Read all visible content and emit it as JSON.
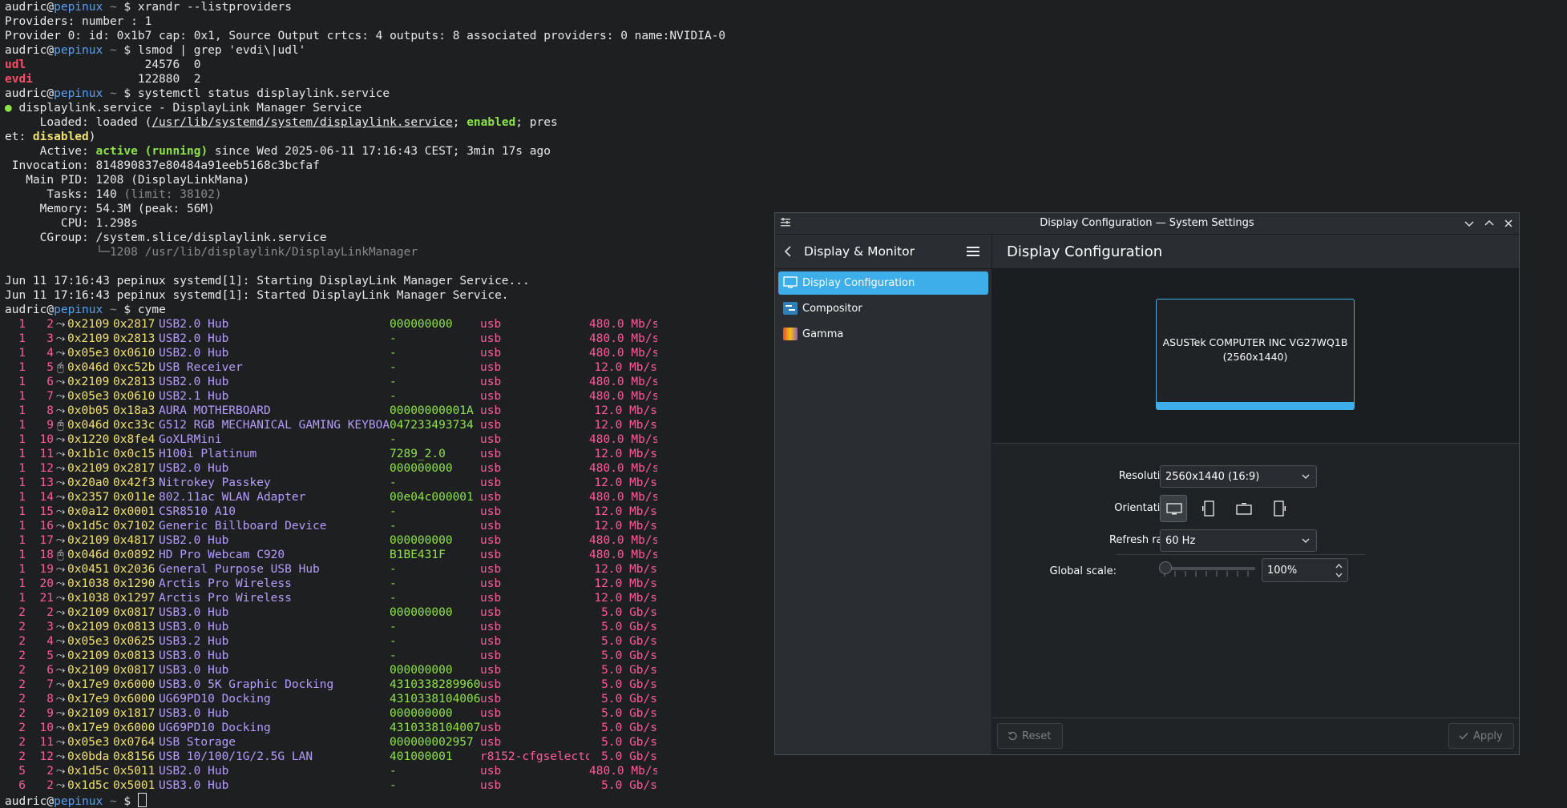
{
  "terminal": {
    "prompt_user": "audric@",
    "prompt_host": "pepinux",
    "prompt_tilde": " ~ ",
    "prompt_symbol": "$ ",
    "cmd1": "xrandr --listproviders",
    "out1a": "Providers: number : 1",
    "out1b": "Provider 0: id: 0x1b7 cap: 0x1, Source Output crtcs: 4 outputs: 8 associated providers: 0 name:NVIDIA-0",
    "cmd2": "lsmod | grep 'evdi\\|udl'",
    "mod1_name": "udl",
    "mod1_rest": "                 24576  0",
    "mod2_name": "evdi",
    "mod2_rest": "               122880  2",
    "cmd3": "systemctl status displaylink.service",
    "st_bullet": "●",
    "st_head": " displaylink.service - DisplayLink Manager Service",
    "st_loaded_pre": "     Loaded: loaded (",
    "st_loaded_path": "/usr/lib/systemd/system/displaylink.service",
    "st_loaded_sep": "; ",
    "st_enabled": "enabled",
    "st_loaded_post": "; pres",
    "st_et": "et: ",
    "st_disabled": "disabled",
    "st_close": ")",
    "st_active_pre": "     Active: ",
    "st_active_val": "active (running)",
    "st_active_post": " since Wed 2025-06-11 17:16:43 CEST; 3min 17s ago",
    "st_invocation": " Invocation: 814890837e80484a91eeb5168c3bcfaf",
    "st_pid": "   Main PID: 1208 (DisplayLinkMana)",
    "st_tasks_pre": "      Tasks: 140 ",
    "st_tasks_limit": "(limit: 38102)",
    "st_memory": "     Memory: 54.3M (peak: 56M)",
    "st_cpu": "        CPU: 1.298s",
    "st_cgroup": "     CGroup: /system.slice/displaylink.service",
    "st_cgroup_child": "             └─1208 /usr/lib/displaylink/DisplayLinkManager",
    "log1": "Jun 11 17:16:43 pepinux systemd[1]: Starting DisplayLink Manager Service...",
    "log2": "Jun 11 17:16:43 pepinux systemd[1]: Started DisplayLink Manager Service.",
    "cmd4": "cyme"
  },
  "cyme_rows": [
    {
      "bus": "1",
      "dev": "2",
      "icon": "⤳",
      "vid": "0x2109",
      "pid": "0x2817",
      "name": "USB2.0 Hub",
      "serial": "000000000",
      "driver": "usb",
      "speed": "480.0 Mb/s"
    },
    {
      "bus": "1",
      "dev": "3",
      "icon": "⤳",
      "vid": "0x2109",
      "pid": "0x2813",
      "name": "USB2.0 Hub",
      "serial": "-",
      "driver": "usb",
      "speed": "480.0 Mb/s"
    },
    {
      "bus": "1",
      "dev": "4",
      "icon": "⤳",
      "vid": "0x05e3",
      "pid": "0x0610",
      "name": "USB2.0 Hub",
      "serial": "-",
      "driver": "usb",
      "speed": "480.0 Mb/s"
    },
    {
      "bus": "1",
      "dev": "5",
      "icon": "🖰",
      "vid": "0x046d",
      "pid": "0xc52b",
      "name": "USB Receiver",
      "serial": "-",
      "driver": "usb",
      "speed": "12.0 Mb/s"
    },
    {
      "bus": "1",
      "dev": "6",
      "icon": "⤳",
      "vid": "0x2109",
      "pid": "0x2813",
      "name": "USB2.0 Hub",
      "serial": "-",
      "driver": "usb",
      "speed": "480.0 Mb/s"
    },
    {
      "bus": "1",
      "dev": "7",
      "icon": "⤳",
      "vid": "0x05e3",
      "pid": "0x0610",
      "name": "USB2.1 Hub",
      "serial": "-",
      "driver": "usb",
      "speed": "480.0 Mb/s"
    },
    {
      "bus": "1",
      "dev": "8",
      "icon": "⤳",
      "vid": "0x0b05",
      "pid": "0x18a3",
      "name": "AURA MOTHERBOARD",
      "serial": "00000000001A",
      "driver": "usb",
      "speed": "12.0 Mb/s"
    },
    {
      "bus": "1",
      "dev": "9",
      "icon": "🖰",
      "vid": "0x046d",
      "pid": "0xc33c",
      "name": "G512 RGB MECHANICAL GAMING KEYBOARD",
      "serial": "047233493734",
      "driver": "usb",
      "speed": "12.0 Mb/s"
    },
    {
      "bus": "1",
      "dev": "10",
      "icon": "⤳",
      "vid": "0x1220",
      "pid": "0x8fe4",
      "name": "GoXLRMini",
      "serial": "-",
      "driver": "usb",
      "speed": "480.0 Mb/s"
    },
    {
      "bus": "1",
      "dev": "11",
      "icon": "⤳",
      "vid": "0x1b1c",
      "pid": "0x0c15",
      "name": "H100i Platinum",
      "serial": "7289_2.0",
      "driver": "usb",
      "speed": "12.0 Mb/s"
    },
    {
      "bus": "1",
      "dev": "12",
      "icon": "⤳",
      "vid": "0x2109",
      "pid": "0x2817",
      "name": "USB2.0 Hub",
      "serial": "000000000",
      "driver": "usb",
      "speed": "480.0 Mb/s"
    },
    {
      "bus": "1",
      "dev": "13",
      "icon": "⤳",
      "vid": "0x20a0",
      "pid": "0x42f3",
      "name": "Nitrokey Passkey",
      "serial": "-",
      "driver": "usb",
      "speed": "12.0 Mb/s"
    },
    {
      "bus": "1",
      "dev": "14",
      "icon": "⤳",
      "vid": "0x2357",
      "pid": "0x011e",
      "name": "802.11ac WLAN Adapter",
      "serial": "00e04c000001",
      "driver": "usb",
      "speed": "480.0 Mb/s"
    },
    {
      "bus": "1",
      "dev": "15",
      "icon": "⤳",
      "vid": "0x0a12",
      "pid": "0x0001",
      "name": "CSR8510 A10",
      "serial": "-",
      "driver": "usb",
      "speed": "12.0 Mb/s"
    },
    {
      "bus": "1",
      "dev": "16",
      "icon": "⤳",
      "vid": "0x1d5c",
      "pid": "0x7102",
      "name": "Generic Billboard Device",
      "serial": "-",
      "driver": "usb",
      "speed": "12.0 Mb/s"
    },
    {
      "bus": "1",
      "dev": "17",
      "icon": "⤳",
      "vid": "0x2109",
      "pid": "0x4817",
      "name": "USB2.0 Hub",
      "serial": "000000000",
      "driver": "usb",
      "speed": "480.0 Mb/s"
    },
    {
      "bus": "1",
      "dev": "18",
      "icon": "🖰",
      "vid": "0x046d",
      "pid": "0x0892",
      "name": "HD Pro Webcam C920",
      "serial": "B1BE431F",
      "driver": "usb",
      "speed": "480.0 Mb/s"
    },
    {
      "bus": "1",
      "dev": "19",
      "icon": "⤳",
      "vid": "0x0451",
      "pid": "0x2036",
      "name": "General Purpose USB Hub",
      "serial": "-",
      "driver": "usb",
      "speed": "12.0 Mb/s"
    },
    {
      "bus": "1",
      "dev": "20",
      "icon": "⤳",
      "vid": "0x1038",
      "pid": "0x1290",
      "name": "Arctis Pro Wireless",
      "serial": "-",
      "driver": "usb",
      "speed": "12.0 Mb/s"
    },
    {
      "bus": "1",
      "dev": "21",
      "icon": "⤳",
      "vid": "0x1038",
      "pid": "0x1297",
      "name": "Arctis Pro Wireless",
      "serial": "-",
      "driver": "usb",
      "speed": "12.0 Mb/s"
    },
    {
      "bus": "2",
      "dev": "2",
      "icon": "⤳",
      "vid": "0x2109",
      "pid": "0x0817",
      "name": "USB3.0 Hub",
      "serial": "000000000",
      "driver": "usb",
      "speed": "5.0 Gb/s"
    },
    {
      "bus": "2",
      "dev": "3",
      "icon": "⤳",
      "vid": "0x2109",
      "pid": "0x0813",
      "name": "USB3.0 Hub",
      "serial": "-",
      "driver": "usb",
      "speed": "5.0 Gb/s"
    },
    {
      "bus": "2",
      "dev": "4",
      "icon": "⤳",
      "vid": "0x05e3",
      "pid": "0x0625",
      "name": "USB3.2 Hub",
      "serial": "-",
      "driver": "usb",
      "speed": "5.0 Gb/s"
    },
    {
      "bus": "2",
      "dev": "5",
      "icon": "⤳",
      "vid": "0x2109",
      "pid": "0x0813",
      "name": "USB3.0 Hub",
      "serial": "-",
      "driver": "usb",
      "speed": "5.0 Gb/s"
    },
    {
      "bus": "2",
      "dev": "6",
      "icon": "⤳",
      "vid": "0x2109",
      "pid": "0x0817",
      "name": "USB3.0 Hub",
      "serial": "000000000",
      "driver": "usb",
      "speed": "5.0 Gb/s"
    },
    {
      "bus": "2",
      "dev": "7",
      "icon": "⤳",
      "vid": "0x17e9",
      "pid": "0x6000",
      "name": "USB3.0 5K Graphic Docking",
      "serial": "4310338289960",
      "driver": "usb",
      "speed": "5.0 Gb/s"
    },
    {
      "bus": "2",
      "dev": "8",
      "icon": "⤳",
      "vid": "0x17e9",
      "pid": "0x6000",
      "name": "UG69PD10 Docking",
      "serial": "4310338104006",
      "driver": "usb",
      "speed": "5.0 Gb/s"
    },
    {
      "bus": "2",
      "dev": "9",
      "icon": "⤳",
      "vid": "0x2109",
      "pid": "0x1817",
      "name": "USB3.0 Hub",
      "serial": "000000000",
      "driver": "usb",
      "speed": "5.0 Gb/s"
    },
    {
      "bus": "2",
      "dev": "10",
      "icon": "⤳",
      "vid": "0x17e9",
      "pid": "0x6000",
      "name": "UG69PD10 Docking",
      "serial": "4310338104007",
      "driver": "usb",
      "speed": "5.0 Gb/s"
    },
    {
      "bus": "2",
      "dev": "11",
      "icon": "⤳",
      "vid": "0x05e3",
      "pid": "0x0764",
      "name": "USB Storage",
      "serial": "000000002957",
      "driver": "usb",
      "speed": "5.0 Gb/s"
    },
    {
      "bus": "2",
      "dev": "12",
      "icon": "⤳",
      "vid": "0x0bda",
      "pid": "0x8156",
      "name": "USB 10/100/1G/2.5G LAN",
      "serial": "401000001",
      "driver": "r8152-cfgselector",
      "speed": "5.0 Gb/s"
    },
    {
      "bus": "5",
      "dev": "2",
      "icon": "⤳",
      "vid": "0x1d5c",
      "pid": "0x5011",
      "name": "USB2.0 Hub",
      "serial": "-",
      "driver": "usb",
      "speed": "480.0 Mb/s"
    },
    {
      "bus": "6",
      "dev": "2",
      "icon": "⤳",
      "vid": "0x1d5c",
      "pid": "0x5001",
      "name": "USB3.0 Hub",
      "serial": "-",
      "driver": "usb",
      "speed": "5.0 Gb/s"
    }
  ],
  "window": {
    "title": "Display Configuration — System Settings",
    "sidebar_title": "Display & Monitor",
    "sidebar_items": [
      {
        "label": "Display Configuration"
      },
      {
        "label": "Compositor"
      },
      {
        "label": "Gamma"
      }
    ],
    "page_title": "Display Configuration",
    "monitor_name": "ASUSTek COMPUTER INC VG27WQ1B",
    "monitor_res": "(2560x1440)",
    "resolution_label": "Resolution:",
    "resolution_value": "2560x1440 (16:9)",
    "orientation_label": "Orientation:",
    "refresh_label": "Refresh rate:",
    "refresh_value": "60 Hz",
    "scale_label": "Global scale:",
    "scale_value": "100%",
    "scale_level": 0,
    "reset_label": "Reset",
    "apply_label": "Apply",
    "accent": "#3daee9"
  }
}
